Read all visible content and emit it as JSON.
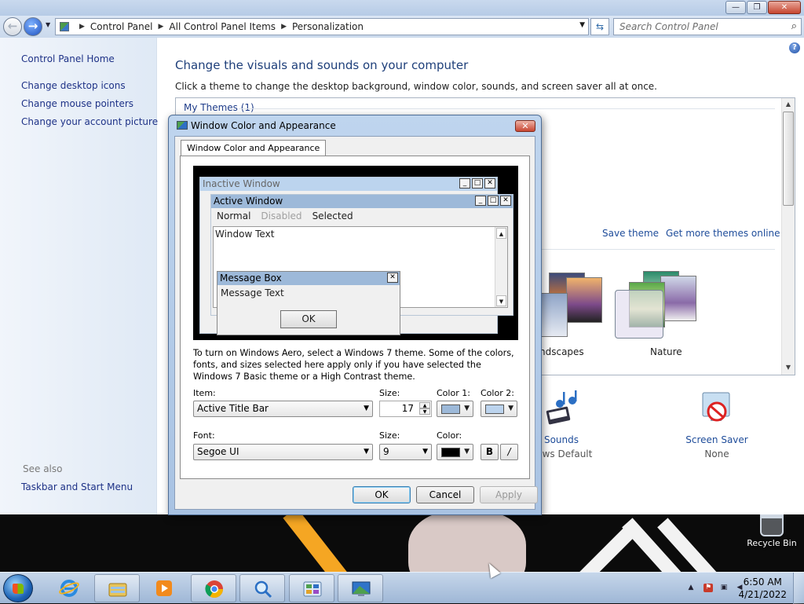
{
  "window": {
    "address": {
      "crumbs": [
        "Control Panel",
        "All Control Panel Items",
        "Personalization"
      ],
      "search_placeholder": "Search Control Panel"
    },
    "caption_buttons": {
      "minimize": "—",
      "maximize": "❐",
      "close": "✕"
    }
  },
  "sidebar": {
    "home": "Control Panel Home",
    "links": [
      "Change desktop icons",
      "Change mouse pointers",
      "Change your account picture"
    ],
    "see_also_label": "See also",
    "see_also_links": [
      "Taskbar and Start Menu"
    ]
  },
  "main": {
    "title": "Change the visuals and sounds on your computer",
    "subtitle": "Click a theme to change the desktop background, window color, sounds, and screen saver all at once.",
    "my_themes": "My Themes (1)",
    "save_theme": "Save theme",
    "get_more": "Get more themes online",
    "themes": [
      {
        "name": "ndscapes"
      },
      {
        "name": "Nature"
      }
    ],
    "bottom_items": [
      {
        "label": "Sounds",
        "sub": "dows Default",
        "icon": "music-notes-icon"
      },
      {
        "label": "Screen Saver",
        "sub": "None",
        "icon": "screen-saver-icon"
      }
    ]
  },
  "dialog": {
    "title": "Window Color and Appearance",
    "tab": "Window Color and Appearance",
    "preview": {
      "inactive_window": "Inactive Window",
      "active_window": "Active Window",
      "menu": {
        "normal": "Normal",
        "disabled": "Disabled",
        "selected": "Selected"
      },
      "window_text": "Window Text",
      "message_box": "Message Box",
      "message_text": "Message Text",
      "ok": "OK"
    },
    "note": "To turn on Windows Aero, select a Windows 7 theme.  Some of the colors, fonts, and sizes selected here apply only if you have selected the Windows 7 Basic theme or a High Contrast theme.",
    "labels": {
      "item": "Item:",
      "size": "Size:",
      "color1": "Color 1:",
      "color2": "Color 2:",
      "font": "Font:",
      "font_size": "Size:",
      "color": "Color:"
    },
    "item_value": "Active Title Bar",
    "item_size": "17",
    "color1": "#9db9d9",
    "color2": "#bcd4ee",
    "font_value": "Segoe UI",
    "font_size_value": "9",
    "font_color": "#000000",
    "bold_label": "B",
    "italic_label": "/",
    "buttons": {
      "ok": "OK",
      "cancel": "Cancel",
      "apply": "Apply"
    }
  },
  "desktop": {
    "recycle_bin": "Recycle Bin"
  },
  "taskbar": {
    "pinned": [
      "internet-explorer-icon",
      "file-explorer-icon",
      "media-player-icon",
      "chrome-icon",
      "magnifier-icon",
      "control-panel-icon",
      "personalization-icon"
    ],
    "clock_time": "6:50 AM",
    "clock_date": "4/21/2022"
  },
  "colors": {
    "link": "#1e3287",
    "accent": "#1e3f7a",
    "titlebar": "#b6cbe6",
    "preview_active_title": "#9db9d9"
  }
}
